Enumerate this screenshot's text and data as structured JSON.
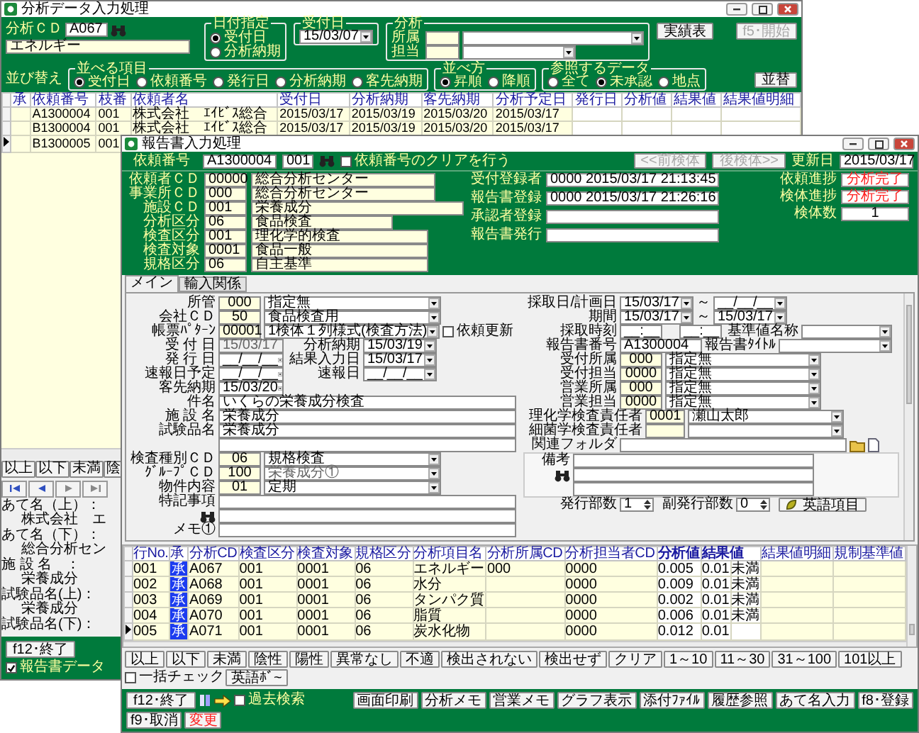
{
  "back_window": {
    "title": "分析データ入力処理",
    "analysis_cd": {
      "label": "分析ＣＤ",
      "code": "A067",
      "name": "エネルギー"
    },
    "date_spec": {
      "legend": "日付指定",
      "options": [
        {
          "label": "受付日",
          "selected": true
        },
        {
          "label": "分析納期",
          "selected": false
        }
      ]
    },
    "received": {
      "legend": "受付日",
      "value": "15/03/07"
    },
    "analysis": {
      "legend": "分析",
      "fields": [
        {
          "label": "所属"
        },
        {
          "label": "担当"
        }
      ]
    },
    "results_button": "実績表",
    "start_button": {
      "label": "f5･開始",
      "disabled": true
    },
    "sort_label": "並び替え",
    "sort_items": {
      "legend": "並べる項目",
      "options": [
        {
          "label": "受付日",
          "selected": true
        },
        {
          "label": "依頼番号",
          "selected": false
        },
        {
          "label": "発行日",
          "selected": false
        },
        {
          "label": "分析納期",
          "selected": false
        },
        {
          "label": "客先納期",
          "selected": false
        }
      ]
    },
    "sort_order": {
      "legend": "並べ方",
      "options": [
        {
          "label": "昇順",
          "selected": true
        },
        {
          "label": "降順",
          "selected": false
        }
      ]
    },
    "data_ref": {
      "legend": "参照するデータ",
      "options": [
        {
          "label": "全て",
          "selected": false
        },
        {
          "label": "未承認",
          "selected": true
        },
        {
          "label": "地点",
          "selected": false
        }
      ]
    },
    "sort_button": "並替",
    "table": {
      "columns": [
        "承",
        "依頼番号",
        "枝番",
        "依頼者名",
        "受付日",
        "分析納期",
        "客先納期",
        "分析予定日",
        "発行日",
        "分析値",
        "結果値",
        "結果値明細"
      ],
      "rows": [
        {
          "current": false,
          "request_no": "A1300004",
          "branch": "001",
          "client": "株式会社　ｴｲﾋﾞｽ総合",
          "received": "2015/03/17",
          "analysis_due": "2015/03/19",
          "customer_due": "2015/03/20",
          "planned": "2015/03/17"
        },
        {
          "current": false,
          "request_no": "B1300004",
          "branch": "001",
          "client": "株式会社　ｴｲﾋﾞｽ総合",
          "received": "2015/03/17",
          "analysis_due": "2015/03/19",
          "customer_due": "2015/03/20",
          "planned": "2015/03/17"
        },
        {
          "current": true,
          "request_no": "B1300005",
          "branch": "001"
        }
      ]
    },
    "filter_buttons": [
      "以上",
      "以下",
      "未満",
      "陰"
    ],
    "address_lines": [
      {
        "label": "あて名（上）：",
        "value": "株式会社　エ"
      },
      {
        "label": "あて名（下）：",
        "value": "総合分析セン"
      },
      {
        "label": "施 設 名　：",
        "value": "栄養成分"
      },
      {
        "label": "試験品名(上)：",
        "value": "栄養成分"
      },
      {
        "label": "試験品名(下)："
      }
    ],
    "exit_button": "f12･終了",
    "report_data": {
      "label": "報告書データ",
      "checked": true
    }
  },
  "report_window": {
    "title": "報告書入力処理",
    "request_no": {
      "label": "依頼番号",
      "value": "A1300004",
      "branch": "001"
    },
    "clear_option": {
      "label": "依頼番号のクリアを行う",
      "checked": false
    },
    "nav_buttons": [
      {
        "label": "<<前検体",
        "disabled": true
      },
      {
        "label": "後検体>>",
        "disabled": true
      }
    ],
    "updated": {
      "label": "更新日",
      "value": "2015/03/17"
    },
    "info_rows": [
      {
        "label": "依頼者ＣＤ",
        "code": "00000",
        "name": "総合分析センター"
      },
      {
        "label": "事業所ＣＤ",
        "code": "000",
        "name": "総合分析センター"
      },
      {
        "label": "施設ＣＤ",
        "code": "001",
        "name": "栄養成分"
      },
      {
        "label": "分析区分",
        "code": "06",
        "name": "食品検査"
      },
      {
        "label": "検査区分",
        "code": "001",
        "name": "理化学的検査"
      },
      {
        "label": "検査対象",
        "code": "0001",
        "name": "食品一般"
      },
      {
        "label": "規格区分",
        "code": "06",
        "name": "自主基準"
      }
    ],
    "registrations": [
      {
        "label": "受付登録者",
        "value": "0000 2015/03/17 21:13:45"
      },
      {
        "label": "報告書登録",
        "value": "0000 2015/03/17 21:26:16"
      },
      {
        "label": "承認者登録"
      },
      {
        "label": "報告書発行"
      }
    ],
    "progress": [
      {
        "label": "依頼進捗",
        "value": "分析完了",
        "kind": "status"
      },
      {
        "label": "検体進捗",
        "value": "分析完了",
        "kind": "status"
      },
      {
        "label": "検体数",
        "value": "1",
        "kind": "count"
      }
    ],
    "tabs": [
      {
        "label": "メイン",
        "selected": true
      },
      {
        "label": "輸入関係",
        "selected": false
      }
    ],
    "form": {
      "jurisdiction": {
        "label": "所管",
        "code": "000",
        "value": "指定無"
      },
      "company": {
        "label": "会社ＣＤ",
        "code": "50",
        "value": "食品検査用"
      },
      "form_pattern": {
        "label": "帳票ﾊﾟﾀｰﾝ",
        "code": "00001",
        "value": "1検体１列様式(検査方法)"
      },
      "request_update": {
        "label": "依頼更新",
        "checked": false
      },
      "received": {
        "label": "受 付 日",
        "value": "15/03/17"
      },
      "analysis_due": {
        "label": "分析納期",
        "value": "15/03/19"
      },
      "customer_due": {
        "label": "客先納期",
        "value": "15/03/20"
      },
      "issued": {
        "label": "発 行 日",
        "value": "__/__/__"
      },
      "result_entry": {
        "label": "結果入力日",
        "value": "15/03/17"
      },
      "prelim_planned": {
        "label": "速報日予定",
        "value": "__/__/__"
      },
      "prelim": {
        "label": "速報日",
        "value": "__/__/__"
      },
      "subject": {
        "label": "件名",
        "value": "いくらの栄養成分検査"
      },
      "facility": {
        "label": "施 設 名",
        "value": "栄養成分"
      },
      "sample": {
        "label": "試験品名",
        "value": "栄養成分"
      },
      "test_type": {
        "label": "検査種別ＣＤ",
        "code": "06",
        "value": "規格検査"
      },
      "group": {
        "label": "ｸﾞﾙｰﾌﾟＣＤ",
        "code": "100",
        "value": "栄養成分①",
        "disabled": true
      },
      "content": {
        "label": "物件内容",
        "code": "01",
        "value": "定期"
      },
      "special_notes": {
        "label": "特記事項"
      },
      "memo": {
        "label": "メモ①"
      },
      "sampling_date": {
        "label": "採取日/計画日",
        "from": "15/03/17",
        "sep": "～",
        "to": "__/__/__"
      },
      "period": {
        "label": "期間",
        "from": "15/03/17",
        "sep": "～",
        "to": "15/03/17"
      },
      "sampling_time": {
        "label": "採取時刻",
        "from": "__:__",
        "to": "__:__"
      },
      "standard_name": {
        "label": "基準値名称"
      },
      "report_no": {
        "label": "報告書番号",
        "value": "A1300004"
      },
      "report_title": {
        "label": "報告書ﾀｲﾄﾙ"
      },
      "assignments": [
        {
          "label": "受付所属",
          "code": "000",
          "value": "指定無"
        },
        {
          "label": "受付担当",
          "code": "0000",
          "value": "指定無"
        },
        {
          "label": "営業所属",
          "code": "000",
          "value": "指定無"
        },
        {
          "label": "営業担当",
          "code": "0000",
          "value": "指定無"
        }
      ],
      "managers": [
        {
          "label": "理化学検査責任者",
          "code": "0001",
          "value": "瀬山太郎"
        },
        {
          "label": "細菌学検査責任者"
        }
      ],
      "folder": {
        "label": "関連フォルダ"
      },
      "notes": {
        "label": "備考"
      },
      "copies": {
        "label": "発行部数",
        "value": "1"
      },
      "sub_copies": {
        "label": "副発行部数",
        "value": "0"
      },
      "english_items": "英語項目"
    },
    "grid": {
      "columns": [
        {
          "label": "行No.",
          "bold": false
        },
        {
          "label": "承",
          "bold": false
        },
        {
          "label": "分析CD",
          "bold": false
        },
        {
          "label": "検査区分",
          "bold": false
        },
        {
          "label": "検査対象",
          "bold": false
        },
        {
          "label": "規格区分",
          "bold": false
        },
        {
          "label": "分析項目名",
          "bold": false
        },
        {
          "label": "分析所属CD",
          "bold": false
        },
        {
          "label": "分析担当者CD",
          "bold": false
        },
        {
          "label": "分析値",
          "bold": true
        },
        {
          "label": "結果値",
          "bold": true
        },
        {
          "label": "結果値明細",
          "bold": false
        },
        {
          "label": "規制基準値",
          "bold": false
        }
      ],
      "rows": [
        {
          "current": false,
          "no": "001",
          "approval": "承",
          "code": "A067",
          "category": "001",
          "target": "0001",
          "standard": "06",
          "item": "エネルギー",
          "dept": "000",
          "staff": "0000",
          "value": "0.005",
          "result": "0.01",
          "qualifier": "未満"
        },
        {
          "current": false,
          "no": "002",
          "approval": "承",
          "code": "A068",
          "category": "001",
          "target": "0001",
          "standard": "06",
          "item": "水分",
          "staff": "0000",
          "value": "0.009",
          "result": "0.01",
          "qualifier": "未満"
        },
        {
          "current": false,
          "no": "003",
          "approval": "承",
          "code": "A069",
          "category": "001",
          "target": "0001",
          "standard": "06",
          "item": "タンパク質",
          "staff": "0000",
          "value": "0.002",
          "result": "0.01",
          "qualifier": "未満"
        },
        {
          "current": false,
          "no": "004",
          "approval": "承",
          "code": "A070",
          "category": "001",
          "target": "0001",
          "standard": "06",
          "item": "脂質",
          "staff": "0000",
          "value": "0.006",
          "result": "0.01",
          "qualifier": "未満"
        },
        {
          "current": true,
          "no": "005",
          "approval": "承",
          "code": "A071",
          "category": "001",
          "target": "0001",
          "standard": "06",
          "item": "炭水化物",
          "staff": "0000",
          "value": "0.012",
          "result": "0.01"
        }
      ]
    },
    "filter_buttons": [
      "以上",
      "以下",
      "未満",
      "陰性",
      "陽性",
      "異常なし",
      "不適",
      "検出されない",
      "検出せず",
      "クリア",
      "1～10",
      "11～30",
      "31～100",
      "101以上"
    ],
    "batch_check": {
      "label": "一括チェック",
      "checked": false
    },
    "english_button": "英語ﾎﾞ~",
    "exit_button": "f12･終了",
    "past_search": {
      "label": "過去検索",
      "checked": false
    },
    "action_buttons": [
      {
        "label": "画面印刷",
        "kind": "normal"
      },
      {
        "label": "分析メモ",
        "kind": "normal"
      },
      {
        "label": "営業メモ",
        "kind": "normal"
      },
      {
        "label": "グラフ表示",
        "kind": "normal"
      },
      {
        "label": "添付ﾌｧｲﾙ",
        "kind": "normal"
      },
      {
        "label": "履歴参照",
        "kind": "normal"
      },
      {
        "label": "あて名入力",
        "kind": "normal"
      },
      {
        "label": "f8･登録",
        "kind": "normal"
      },
      {
        "label": "f9･取消",
        "kind": "normal"
      },
      {
        "label": "変更",
        "kind": "alert"
      }
    ]
  }
}
